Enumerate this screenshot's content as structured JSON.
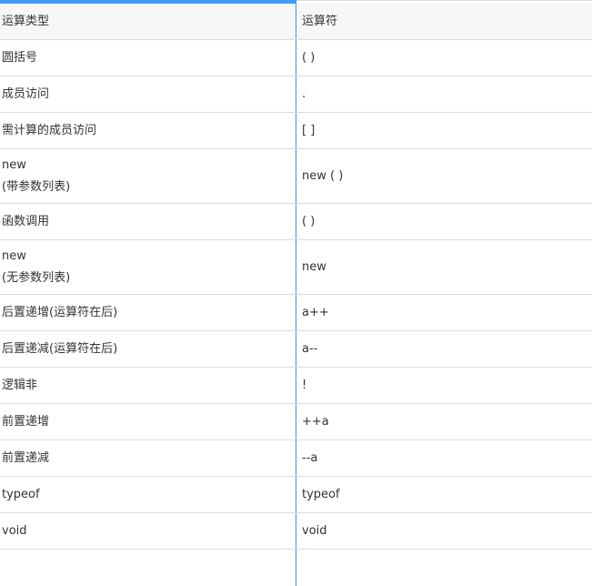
{
  "table": {
    "headers": [
      "运算类型",
      "运算符"
    ],
    "rows": [
      {
        "type": [
          "圆括号"
        ],
        "op": "( )"
      },
      {
        "type": [
          "成员访问"
        ],
        "op": "."
      },
      {
        "type": [
          "需计算的成员访问"
        ],
        "op": "[ ]"
      },
      {
        "type": [
          "new",
          "(带参数列表)"
        ],
        "op": "new ( )"
      },
      {
        "type": [
          "函数调用"
        ],
        "op": "( )"
      },
      {
        "type": [
          "new",
          "(无参数列表)"
        ],
        "op": "new"
      },
      {
        "type": [
          "后置递增(运算符在后)"
        ],
        "op": "a++"
      },
      {
        "type": [
          "后置递减(运算符在后)"
        ],
        "op": "a--"
      },
      {
        "type": [
          "逻辑非"
        ],
        "op": "!"
      },
      {
        "type": [
          "前置递增"
        ],
        "op": "++a"
      },
      {
        "type": [
          "前置递减"
        ],
        "op": "--a"
      },
      {
        "type": [
          "typeof"
        ],
        "op": "typeof"
      },
      {
        "type": [
          "void"
        ],
        "op": "void"
      }
    ]
  },
  "colors": {
    "accent_bar": "#3f9cf5",
    "column_divider": "#4a90d9",
    "row_border": "#dcdcdc",
    "header_bg": "#f7f7f7",
    "text": "#333333"
  }
}
